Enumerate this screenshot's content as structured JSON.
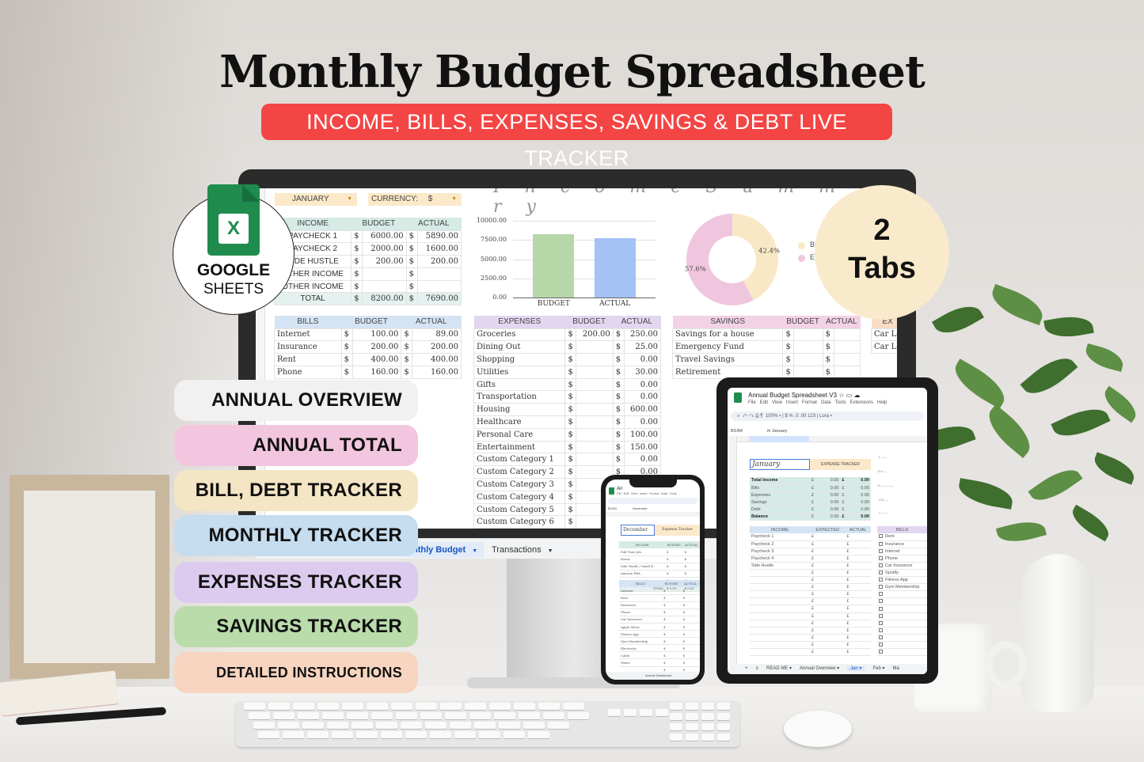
{
  "header": {
    "title": "Monthly Budget Spreadsheet",
    "subtitle": "INCOME, BILLS, EXPENSES, SAVINGS & DEBT LIVE TRACKER"
  },
  "badges": {
    "google": "GOOGLE",
    "sheets": "SHEETS",
    "sheets_icon_letter": "X",
    "tabs_count": "2",
    "tabs_label": "Tabs"
  },
  "features": [
    {
      "label": "ANNUAL OVERVIEW",
      "color": "#f0f1f0"
    },
    {
      "label": "ANNUAL TOTAL",
      "color": "#f2c6de"
    },
    {
      "label": "BILL, DEBT TRACKER",
      "color": "#f4e6c4"
    },
    {
      "label": "MONTHLY TRACKER",
      "color": "#c6dcef"
    },
    {
      "label": "EXPENSES TRACKER",
      "color": "#dccbef"
    },
    {
      "label": "SAVINGS TRACKER",
      "color": "#b9dcaa"
    },
    {
      "label": "DETAILED INSTRUCTIONS",
      "color": "#f7d5c0"
    }
  ],
  "monitor": {
    "month_select": "JANUARY",
    "currency_label": "CURRENCY:",
    "currency_value": "$",
    "script_heading": "I n c o m e   S u m m a r y",
    "income": {
      "headers": [
        "INCOME",
        "BUDGET",
        "ACTUAL"
      ],
      "rows": [
        {
          "name": "PAYCHECK 1",
          "budget": "6000.00",
          "actual": "5890.00"
        },
        {
          "name": "PAYCHECK 2",
          "budget": "2000.00",
          "actual": "1600.00"
        },
        {
          "name": "SIDE HUSTLE",
          "budget": "200.00",
          "actual": "200.00"
        },
        {
          "name": "OTHER INCOME",
          "budget": "",
          "actual": ""
        },
        {
          "name": "OTHER INCOME",
          "budget": "",
          "actual": ""
        }
      ],
      "total_label": "TOTAL",
      "total_budget": "8200.00",
      "total_actual": "7690.00"
    },
    "bills": {
      "headers": [
        "BILLS",
        "BUDGET",
        "ACTUAL"
      ],
      "rows": [
        {
          "name": "Internet",
          "budget": "100.00",
          "actual": "89.00"
        },
        {
          "name": "Insurance",
          "budget": "200.00",
          "actual": "200.00"
        },
        {
          "name": "Rent",
          "budget": "400.00",
          "actual": "400.00"
        },
        {
          "name": "Phone",
          "budget": "160.00",
          "actual": "160.00"
        }
      ]
    },
    "expenses": {
      "headers": [
        "EXPENSES",
        "BUDGET",
        "ACTUAL"
      ],
      "rows": [
        {
          "name": "Groceries",
          "budget": "200.00",
          "actual": "250.00"
        },
        {
          "name": "Dining Out",
          "budget": "",
          "actual": "25.00"
        },
        {
          "name": "Shopping",
          "budget": "",
          "actual": "0.00"
        },
        {
          "name": "Utilities",
          "budget": "",
          "actual": "30.00"
        },
        {
          "name": "Gifts",
          "budget": "",
          "actual": "0.00"
        },
        {
          "name": "Transportation",
          "budget": "",
          "actual": "0.00"
        },
        {
          "name": "Housing",
          "budget": "",
          "actual": "600.00"
        },
        {
          "name": "Healthcare",
          "budget": "",
          "actual": "0.00"
        },
        {
          "name": "Personal Care",
          "budget": "",
          "actual": "100.00"
        },
        {
          "name": "Entertainment",
          "budget": "",
          "actual": "150.00"
        },
        {
          "name": "Custom Category 1",
          "budget": "",
          "actual": "0.00"
        },
        {
          "name": "Custom Category 2",
          "budget": "",
          "actual": "0.00"
        },
        {
          "name": "Custom Category 3",
          "budget": "",
          "actual": ""
        },
        {
          "name": "Custom Category 4",
          "budget": "",
          "actual": ""
        },
        {
          "name": "Custom Category 5",
          "budget": "",
          "actual": ""
        },
        {
          "name": "Custom Category 6",
          "budget": "",
          "actual": ""
        }
      ]
    },
    "savings": {
      "headers": [
        "SAVINGS",
        "BUDGET",
        "ACTUAL"
      ],
      "rows": [
        {
          "name": "Savings for a house",
          "budget": "",
          "actual": ""
        },
        {
          "name": "Emergency Fund",
          "budget": "",
          "actual": ""
        },
        {
          "name": "Travel Savings",
          "budget": "",
          "actual": ""
        },
        {
          "name": "Retirement",
          "budget": "",
          "actual": ""
        }
      ]
    },
    "debt": {
      "header": "EX",
      "rows": [
        "Car Lo",
        "Car Lo"
      ]
    },
    "currency_symbol": "$",
    "sheet_tabs": [
      {
        "label": "nthly Budget",
        "active": true
      },
      {
        "label": "Transactions",
        "active": false
      }
    ],
    "bar_chart": {
      "type": "bar",
      "categories": [
        "BUDGET",
        "ACTUAL"
      ],
      "values": [
        8200,
        7690
      ],
      "colors": [
        "#b6d7a8",
        "#a4c2f4"
      ],
      "y_ticks": [
        "0.00",
        "2500.00",
        "5000.00",
        "7500.00",
        "10000.00"
      ],
      "ylim": [
        0,
        10000
      ]
    },
    "donut_chart": {
      "type": "pie",
      "slices": [
        {
          "label": "Bi",
          "value": 42.4,
          "text": "42.4%",
          "color": "#f9e8c6"
        },
        {
          "label": "E",
          "value": 57.6,
          "text": "57.6%",
          "color": "#f0c6de"
        }
      ]
    }
  },
  "tablet": {
    "doc_title": "Annual Budget Spreadsheet V3",
    "menu": [
      "File",
      "Edit",
      "View",
      "Insert",
      "Format",
      "Data",
      "Tools",
      "Extensions",
      "Help"
    ],
    "zoom": "100%",
    "font": "Lora",
    "cell_ref": "B3:B4",
    "formula": "January",
    "month": "January",
    "expense_tracker": "EXPENSE TRACKER",
    "summary": [
      {
        "label": "Total Income",
        "a": "0.00",
        "b": "0.00"
      },
      {
        "label": "Bills",
        "a": "0.00",
        "b": "0.00"
      },
      {
        "label": "Expenses",
        "a": "0.00",
        "b": "0.00"
      },
      {
        "label": "Savings",
        "a": "0.00",
        "b": "0.00"
      },
      {
        "label": "Debt",
        "a": "0.00",
        "b": "0.00"
      },
      {
        "label": "Balance",
        "a": "0.00",
        "b": "0.00"
      }
    ],
    "currency_symbol": "£",
    "income_headers": [
      "INCOME",
      "EXPECTED",
      "ACTUAL"
    ],
    "income_rows": [
      "Paycheck 1",
      "Paycheck 2",
      "Paycheck 3",
      "Paycheck 4",
      "Side Hustle",
      "",
      "",
      "",
      "",
      "",
      "",
      "",
      "",
      "",
      "",
      "",
      ""
    ],
    "bills_header": "BILLS",
    "bills_rows": [
      "Rent",
      "Insurance",
      "Internet",
      "Phone",
      "Car Insurance",
      "Spotify",
      "Fitness App",
      "Gym Membership"
    ],
    "sheet_tabs": [
      "READ ME",
      "Annual Overview",
      "Jan",
      "Feb",
      "Ma"
    ],
    "active_tab": "Jan"
  },
  "phone": {
    "doc_title": "An",
    "menu": "File  Edit  View  Insert  Format  Data  Tools",
    "cell_ref": "B2:B3",
    "formula": "December",
    "month": "December",
    "expense_tracker": "Expense Tracker",
    "income_headers": [
      "INCOME",
      "BUDGET",
      "ACTUAL"
    ],
    "income_rows": [
      "Full Time Job",
      "Bonus",
      "Side Hustle / Small B",
      "Amazon FBA"
    ],
    "total_label": "TOTAL",
    "total_value": "0.00",
    "bills_headers": [
      "BILLS",
      "BUDGET",
      "ACTUAL"
    ],
    "bills_rows": [
      "Internet",
      "Rent",
      "Insurance",
      "Phone",
      "Car Insurance",
      "Apple Music",
      "Fitness App",
      "Gym Membership",
      "Electricity",
      "Cable",
      "Water"
    ],
    "sheet_tab": "Annual Dashboard"
  }
}
